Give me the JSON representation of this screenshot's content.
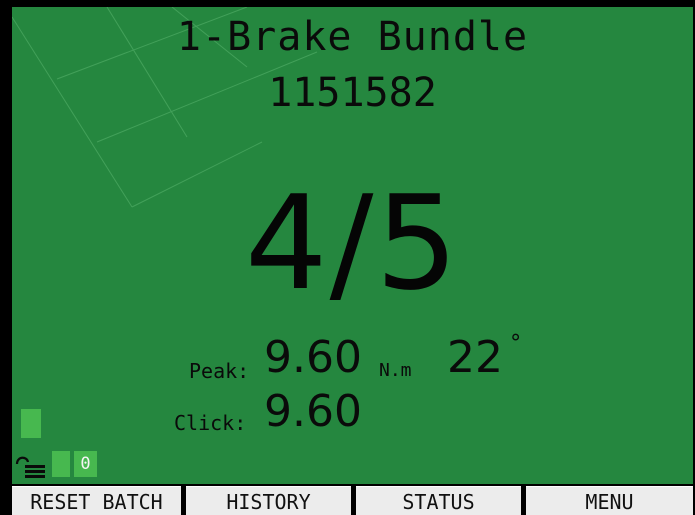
{
  "screen": {
    "title": "1-Brake Bundle",
    "serial": "1151582",
    "count": "4/5"
  },
  "readings": {
    "peak_label": "Peak:",
    "peak_value": "9.60",
    "peak_unit": "N.m",
    "angle_value": "22",
    "angle_unit": "°",
    "click_label": "Click:",
    "click_value": "9.60"
  },
  "status": {
    "batch_counter": "0",
    "lock_icon": "unlocked-padlock-icon"
  },
  "softkeys": [
    {
      "label": "RESET BATCH"
    },
    {
      "label": "HISTORY"
    },
    {
      "label": "STATUS"
    },
    {
      "label": "MENU"
    }
  ],
  "colors": {
    "display_background": "#25873f",
    "indicator": "#47b84f",
    "softkey_background": "#ececec"
  }
}
